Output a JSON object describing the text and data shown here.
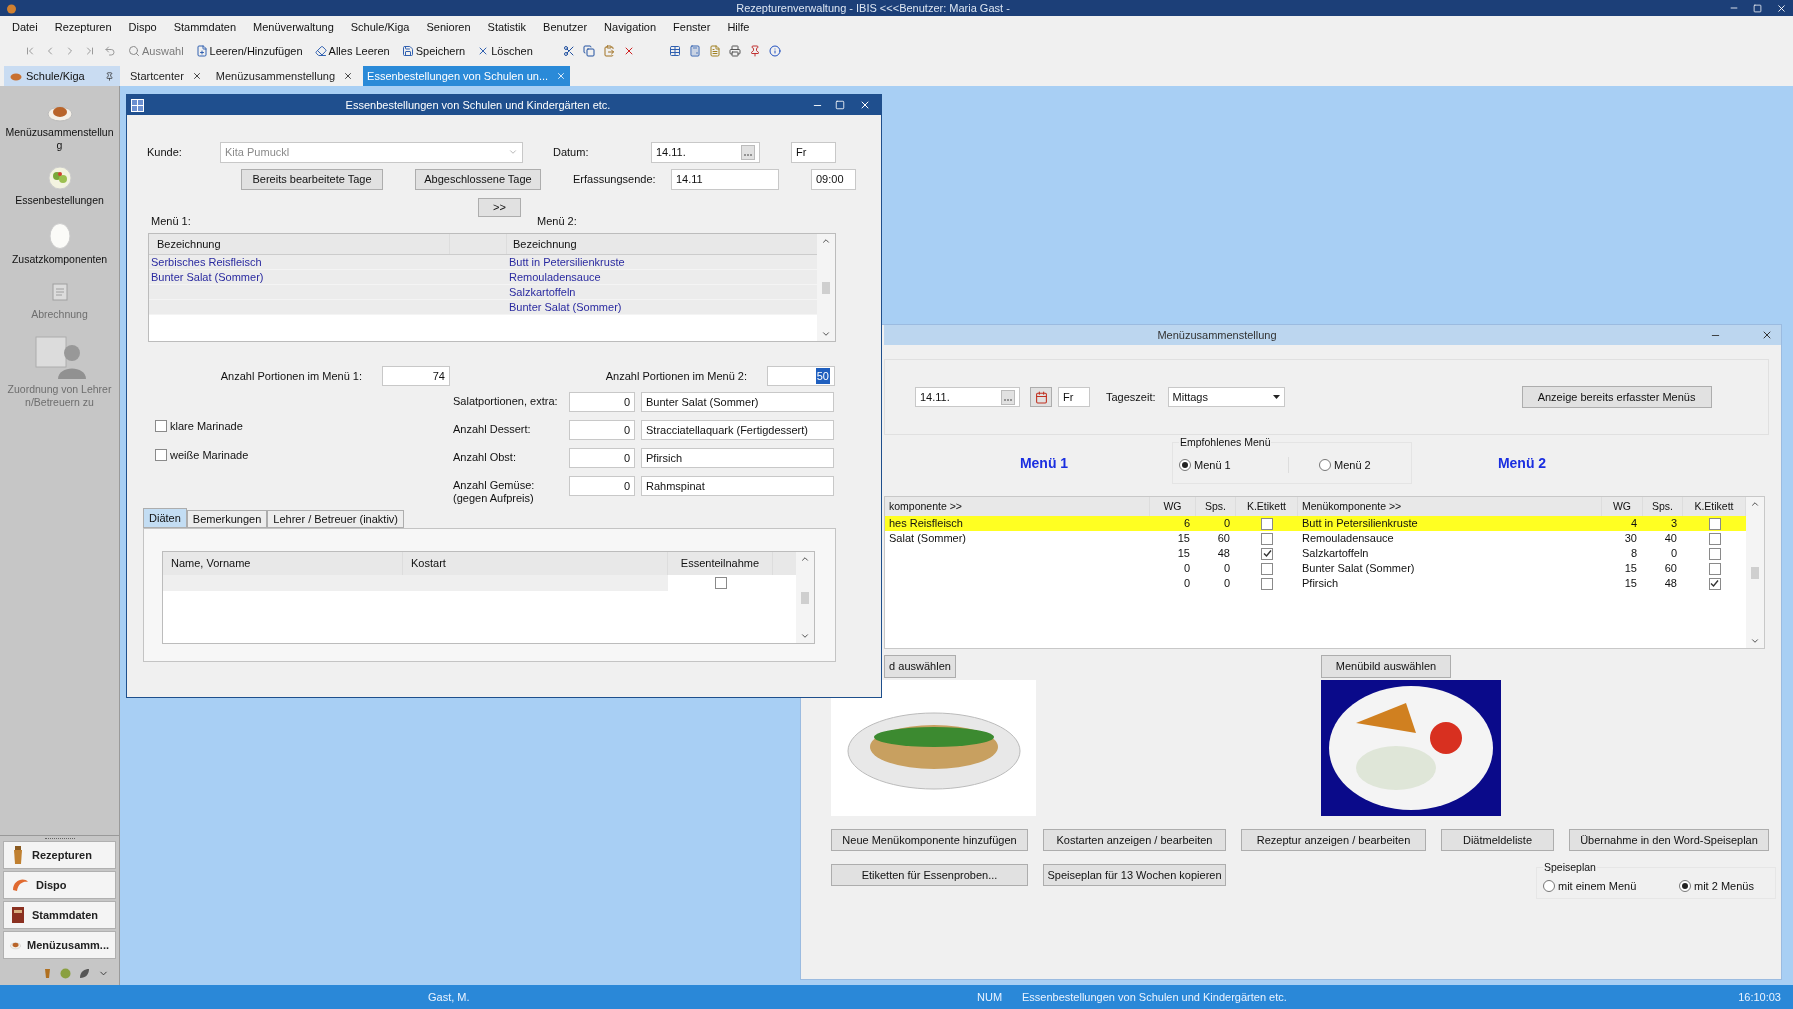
{
  "app_title": "Rezepturenverwaltung - IBIS <<<Benutzer: Maria Gast -",
  "menu": [
    "Datei",
    "Rezepturen",
    "Dispo",
    "Stammdaten",
    "Menüverwaltung",
    "Schule/Kiga",
    "Senioren",
    "Statistik",
    "Benutzer",
    "Navigation",
    "Fenster",
    "Hilfe"
  ],
  "toolbar": [
    {
      "label": "Auswahl",
      "disabled": true
    },
    {
      "label": "Leeren/Hinzufügen",
      "disabled": false
    },
    {
      "label": "Alles Leeren",
      "disabled": false
    },
    {
      "label": "Speichern",
      "disabled": false
    },
    {
      "label": "Löschen",
      "disabled": false
    }
  ],
  "pane_title": "Schule/Kiga",
  "tabs": [
    {
      "label": "Startcenter",
      "selected": false
    },
    {
      "label": "Menüzusammenstellung",
      "selected": false
    },
    {
      "label": "Essenbestellungen von Schulen un...",
      "selected": true
    }
  ],
  "sidebar": {
    "items": [
      {
        "label": "Menüzusammenstellung",
        "kind": "plate",
        "disabled": false
      },
      {
        "label": "Essenbestellungen",
        "kind": "salad",
        "disabled": false
      },
      {
        "label": "Zusatzkomponenten",
        "kind": "egg",
        "disabled": false
      },
      {
        "label": "Abrechnung",
        "kind": "invoice",
        "disabled": true
      },
      {
        "label": "Zuordnung von Lehrern/Betreuern zu",
        "kind": "person",
        "disabled": true
      }
    ],
    "nav": [
      {
        "label": "Rezepturen",
        "kind": "mill"
      },
      {
        "label": "Dispo",
        "kind": "shrimp"
      },
      {
        "label": "Stammdaten",
        "kind": "book"
      },
      {
        "label": "Menüzusamm...",
        "kind": "plate"
      }
    ]
  },
  "order_dialog": {
    "title": "Essenbestellungen von Schulen und Kindergärten etc.",
    "customer_label": "Kunde:",
    "customer": "Kita Pumuckl",
    "customer_disabled": true,
    "date_label": "Datum:",
    "date": "14.11.",
    "weekday": "Fr",
    "end_label": "Erfassungsende:",
    "end_date": "14.11",
    "end_time": "09:00",
    "buttons": [
      "Bereits bearbeitete Tage",
      "Abgeschlossene Tage"
    ],
    "transfer_button": ">>",
    "menu1_label": "Menü 1:",
    "menu2_label": "Menü 2:",
    "menu_table": {
      "columns": [
        "Bezeichnung",
        "Bezeichnung"
      ],
      "rows": [
        {
          "menu1": "Serbisches Reisfleisch",
          "menu2": "Butt in Petersilienkruste"
        },
        {
          "menu1": "Bunter Salat (Sommer)",
          "menu2": "Remouladensauce"
        },
        {
          "menu2": "Salzkartoffeln"
        },
        {
          "menu2": "Bunter Salat (Sommer)"
        }
      ]
    },
    "portions": [
      {
        "label": "Anzahl Portionen im Menü 1:",
        "value": "74",
        "focused": false
      },
      {
        "label": "Anzahl Portionen im Menü 2:",
        "value": "50",
        "focused": true
      }
    ],
    "marinades": [
      {
        "label": "klare Marinade",
        "checked": false
      },
      {
        "label": "weiße Marinade",
        "checked": false
      }
    ],
    "extras": [
      {
        "label": "Salatportionen, extra:",
        "value": "0",
        "item": "Bunter Salat (Sommer)"
      },
      {
        "label": "Anzahl Dessert:",
        "value": "0",
        "item": "Stracciatellaquark (Fertigdessert)"
      },
      {
        "label": "Anzahl Obst:",
        "value": "0",
        "item": "Pfirsich"
      },
      {
        "label": "Anzahl Gemüse:",
        "note": "(gegen Aufpreis)",
        "value": "0",
        "item": "Rahmspinat"
      }
    ],
    "tabs": [
      {
        "label": "Diäten",
        "selected": true
      },
      {
        "label": "Bemerkungen",
        "selected": false
      },
      {
        "label": "Lehrer / Betreuer (inaktiv)",
        "selected": false
      }
    ],
    "diet_table": {
      "columns": [
        "Name, Vorname",
        "Kostart",
        "Essenteilnahme"
      ],
      "rows": [
        {
          "attends": false
        }
      ]
    }
  },
  "menu_window": {
    "title": "Menüzusammenstellung",
    "date": "14.11.",
    "weekday": "Fr",
    "daytime_label": "Tageszeit:",
    "daytime": "Mittags",
    "show_button": "Anzeige bereits erfasster Menüs",
    "menu1_heading": "Menü 1",
    "menu2_heading": "Menü 2",
    "recommended": {
      "title": "Empfohlenes Menü",
      "options": [
        {
          "label": "Menü 1",
          "selected": true
        },
        {
          "label": "Menü 2",
          "selected": false
        }
      ]
    },
    "columns": [
      "komponente >>",
      "WG",
      "Sps.",
      "K.Etikett",
      "Menükomponente >>",
      "WG",
      "Sps.",
      "K.Etikett"
    ],
    "rows": [
      {
        "selected": true,
        "left": {
          "name": "hes Reisfleisch",
          "wg": "6",
          "sps": "0",
          "label": false
        },
        "right": {
          "name": "Butt in Petersilienkruste",
          "wg": "4",
          "sps": "3",
          "label": false
        }
      },
      {
        "selected": false,
        "left": {
          "name": "Salat (Sommer)",
          "wg": "15",
          "sps": "60",
          "label": false
        },
        "right": {
          "name": "Remouladensauce",
          "wg": "30",
          "sps": "40",
          "label": false
        }
      },
      {
        "selected": false,
        "left": {
          "wg": "15",
          "sps": "48",
          "label": true
        },
        "right": {
          "name": "Salzkartoffeln",
          "wg": "8",
          "sps": "0",
          "label": false
        }
      },
      {
        "selected": false,
        "left": {
          "wg": "0",
          "sps": "0",
          "label": false
        },
        "right": {
          "name": "Bunter Salat (Sommer)",
          "wg": "15",
          "sps": "60",
          "label": false
        }
      },
      {
        "selected": false,
        "left": {
          "wg": "0",
          "sps": "0",
          "label": false
        },
        "right": {
          "name": "Pfirsich",
          "wg": "15",
          "sps": "48",
          "label": true
        }
      }
    ],
    "image_buttons": [
      "d auswählen",
      "Menübild auswählen"
    ],
    "actions": [
      [
        "Neue Menükomponente hinzufügen",
        "Kostarten anzeigen / bearbeiten",
        "Rezeptur anzeigen / bearbeiten",
        "Diätmeldeliste",
        "Übernahme in den Word-Speiseplan"
      ],
      [
        "Etiketten für Essenproben...",
        "Speiseplan für 13 Wochen kopieren"
      ]
    ],
    "plan": {
      "title": "Speiseplan",
      "options": [
        {
          "label": "mit einem Menü",
          "selected": false
        },
        {
          "label": "mit 2 Menüs",
          "selected": true
        }
      ]
    }
  },
  "status_bar": {
    "user": "Gast, M.",
    "num": "NUM",
    "message": "Essenbestellungen von Schulen und Kindergärten etc.",
    "time": "16:10:03"
  }
}
